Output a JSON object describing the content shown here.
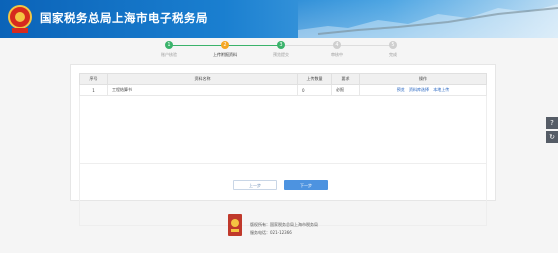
{
  "header": {
    "title": "国家税务总局上海市电子税务局"
  },
  "steps": [
    {
      "num": "1",
      "label": "账户核验",
      "status": "done",
      "color": "#3bb36b"
    },
    {
      "num": "2",
      "label": "上传附报资料",
      "status": "active",
      "color": "#f5a623"
    },
    {
      "num": "3",
      "label": "预览提交",
      "status": "done",
      "color": "#3bb36b"
    },
    {
      "num": "4",
      "label": "审核中",
      "status": "pending",
      "color": "#cfcfcf"
    },
    {
      "num": "5",
      "label": "完成",
      "status": "pending",
      "color": "#cfcfcf"
    }
  ],
  "table": {
    "headers": [
      "序号",
      "资料名称",
      "上传数量",
      "要求",
      "操作"
    ],
    "rows": [
      {
        "index": "1",
        "name": "工程结算书",
        "count": "0",
        "requirement": "必报",
        "actions": [
          "预览",
          "资料库选择",
          "本地上传"
        ]
      }
    ]
  },
  "buttons": {
    "prev": "上一步",
    "next": "下一步"
  },
  "footer": {
    "line1": "版权所有：国家税务总局上海市税务局",
    "line2": "服务电话：021-12366"
  },
  "side_tools": [
    "help-icon",
    "refresh-icon"
  ],
  "colors": {
    "header": "#1a7fd0",
    "link": "#1e5fbf",
    "primary_button": "#4d93e0"
  }
}
